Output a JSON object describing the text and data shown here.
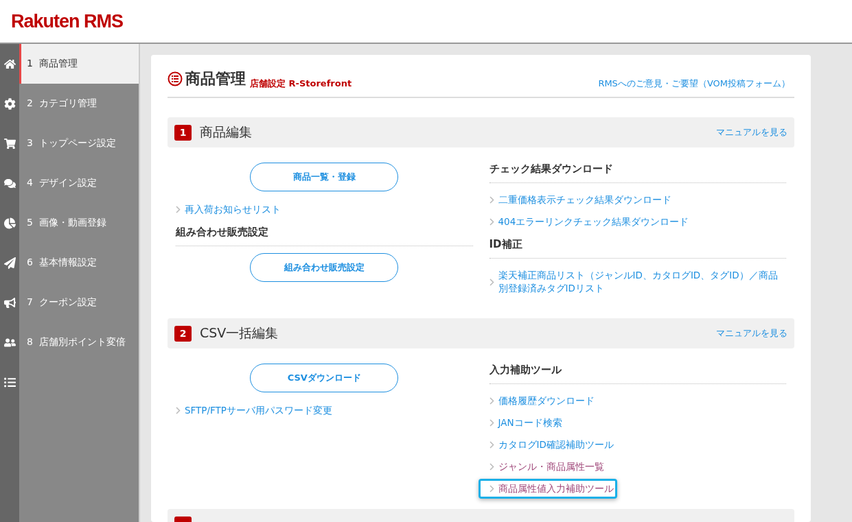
{
  "header": {
    "logo": "Rakuten RMS"
  },
  "sidebar": {
    "items": [
      {
        "number": "1",
        "label": "商品管理",
        "selected": true
      },
      {
        "number": "2",
        "label": "カテゴリ管理",
        "selected": false
      },
      {
        "number": "3",
        "label": "トップページ設定",
        "selected": false
      },
      {
        "number": "4",
        "label": "デザイン設定",
        "selected": false
      },
      {
        "number": "5",
        "label": "画像・動画登録",
        "selected": false
      },
      {
        "number": "6",
        "label": "基本情報設定",
        "selected": false
      },
      {
        "number": "7",
        "label": "クーポン設定",
        "selected": false
      },
      {
        "number": "8",
        "label": "店舗別ポイント変倍",
        "selected": false
      },
      {
        "selected": false
      }
    ]
  },
  "page": {
    "title": "商品管理",
    "subtitle": "店舗設定 R-Storefront",
    "feedback_link": "RMSへのご意見・ご要望（VOM投稿フォーム）"
  },
  "sections": [
    {
      "number": "1",
      "title": "商品編集",
      "manual_link": "マニュアルを見る",
      "left": [
        {
          "kind": "button",
          "label": "商品一覧・登録"
        },
        {
          "kind": "link",
          "label": "再入荷お知らせリスト",
          "visited": false,
          "highlighted": false
        },
        {
          "kind": "heading",
          "label": "組み合わせ販売設定"
        },
        {
          "kind": "button",
          "label": "組み合わせ販売設定"
        }
      ],
      "right": [
        {
          "kind": "heading",
          "label": "チェック結果ダウンロード"
        },
        {
          "kind": "link",
          "label": "二重価格表示チェック結果ダウンロード",
          "visited": false,
          "highlighted": false
        },
        {
          "kind": "link",
          "label": "404エラーリンクチェック結果ダウンロード",
          "visited": false,
          "highlighted": false
        },
        {
          "kind": "heading",
          "label": "ID補正"
        },
        {
          "kind": "link",
          "label": "楽天補正商品リスト（ジャンルID、カタログID、タグID）／商品別登録済みタグIDリスト",
          "visited": false,
          "highlighted": false
        }
      ]
    },
    {
      "number": "2",
      "title": "CSV一括編集",
      "manual_link": "マニュアルを見る",
      "left": [
        {
          "kind": "button",
          "label": "CSVダウンロード"
        },
        {
          "kind": "link",
          "label": "SFTP/FTPサーバ用パスワード変更",
          "visited": false,
          "highlighted": false
        }
      ],
      "right": [
        {
          "kind": "heading",
          "label": "入力補助ツール"
        },
        {
          "kind": "link",
          "label": "価格履歴ダウンロード",
          "visited": false,
          "highlighted": false
        },
        {
          "kind": "link",
          "label": "JANコード検索",
          "visited": false,
          "highlighted": false
        },
        {
          "kind": "link",
          "label": "カタログID確認補助ツール",
          "visited": false,
          "highlighted": false
        },
        {
          "kind": "link",
          "label": "ジャンル・商品属性一覧",
          "visited": true,
          "highlighted": false
        },
        {
          "kind": "link",
          "label": "商品属性値入力補助ツール",
          "visited": true,
          "highlighted": true
        }
      ]
    }
  ]
}
